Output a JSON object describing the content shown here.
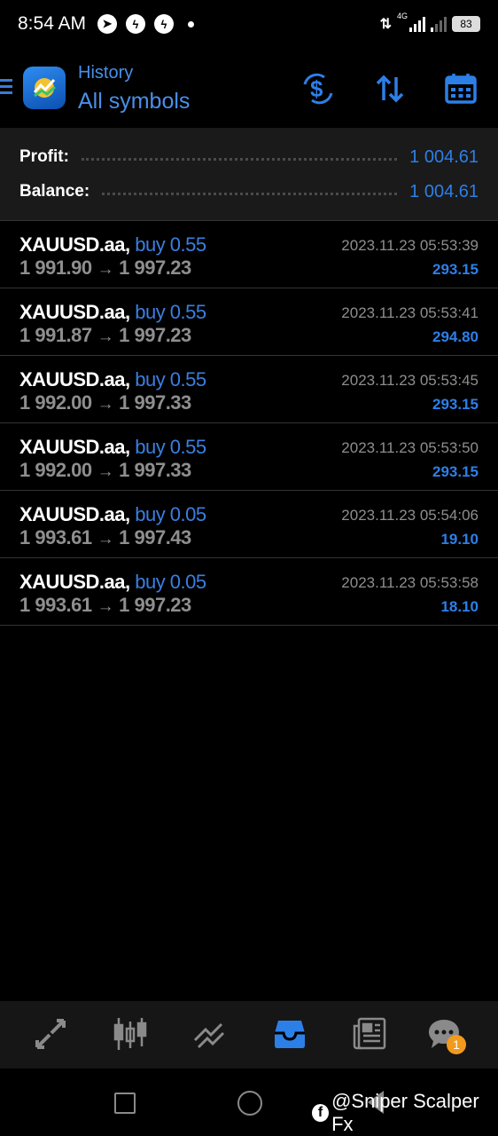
{
  "status_bar": {
    "time": "8:54 AM",
    "notification_icons": [
      "telegram-icon",
      "messenger-icon",
      "messenger-icon"
    ],
    "network_type": "4G",
    "battery": "83"
  },
  "header": {
    "subtitle": "History",
    "title": "All symbols",
    "actions": [
      "currency-exchange-icon",
      "sort-icon",
      "calendar-icon"
    ]
  },
  "summary": {
    "profit_label": "Profit:",
    "profit_value": "1 004.61",
    "balance_label": "Balance:",
    "balance_value": "1 004.61"
  },
  "deals": [
    {
      "symbol": "XAUUSD.aa,",
      "type": "buy 0.55",
      "open": "1 991.90",
      "close": "1 997.23",
      "time": "2023.11.23 05:53:39",
      "profit": "293.15"
    },
    {
      "symbol": "XAUUSD.aa,",
      "type": "buy 0.55",
      "open": "1 991.87",
      "close": "1 997.23",
      "time": "2023.11.23 05:53:41",
      "profit": "294.80"
    },
    {
      "symbol": "XAUUSD.aa,",
      "type": "buy 0.55",
      "open": "1 992.00",
      "close": "1 997.33",
      "time": "2023.11.23 05:53:45",
      "profit": "293.15"
    },
    {
      "symbol": "XAUUSD.aa,",
      "type": "buy 0.55",
      "open": "1 992.00",
      "close": "1 997.33",
      "time": "2023.11.23 05:53:50",
      "profit": "293.15"
    },
    {
      "symbol": "XAUUSD.aa,",
      "type": "buy 0.05",
      "open": "1 993.61",
      "close": "1 997.43",
      "time": "2023.11.23 05:54:06",
      "profit": "19.10"
    },
    {
      "symbol": "XAUUSD.aa,",
      "type": "buy 0.05",
      "open": "1 993.61",
      "close": "1 997.23",
      "time": "2023.11.23 05:53:58",
      "profit": "18.10"
    }
  ],
  "price_arrow": "→",
  "bottom_nav": {
    "items": [
      "quotes-icon",
      "chart-icon",
      "trade-icon",
      "history-icon",
      "news-icon",
      "chat-icon"
    ],
    "active": "history-icon",
    "chat_badge": "1"
  },
  "watermark": "@Sniper Scalper Fx",
  "colors": {
    "accent": "#2d7fe8",
    "background": "#000000",
    "summary_bg": "#1a1a1a",
    "muted": "#8e8e8e",
    "badge": "#f29a1d"
  }
}
